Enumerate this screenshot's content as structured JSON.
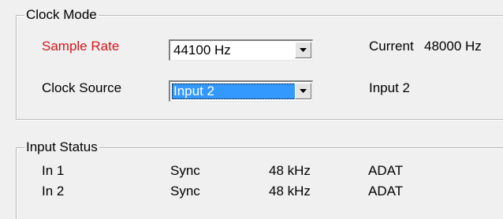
{
  "clock_mode": {
    "title": "Clock Mode",
    "sample_rate": {
      "label": "Sample Rate",
      "value": "44100 Hz",
      "current_label": "Current",
      "current_value": "48000 Hz"
    },
    "clock_source": {
      "label": "Clock Source",
      "value": "Input 2",
      "status": "Input 2"
    }
  },
  "input_status": {
    "title": "Input Status",
    "rows": [
      {
        "name": "In 1",
        "sync": "Sync",
        "rate": "48 kHz",
        "format": "ADAT"
      },
      {
        "name": "In 2",
        "sync": "Sync",
        "rate": "48 kHz",
        "format": "ADAT"
      }
    ]
  },
  "colors": {
    "accent_label": "#d4161d",
    "selection": "#3399ff"
  },
  "icons": [
    "chevron-down-icon"
  ]
}
